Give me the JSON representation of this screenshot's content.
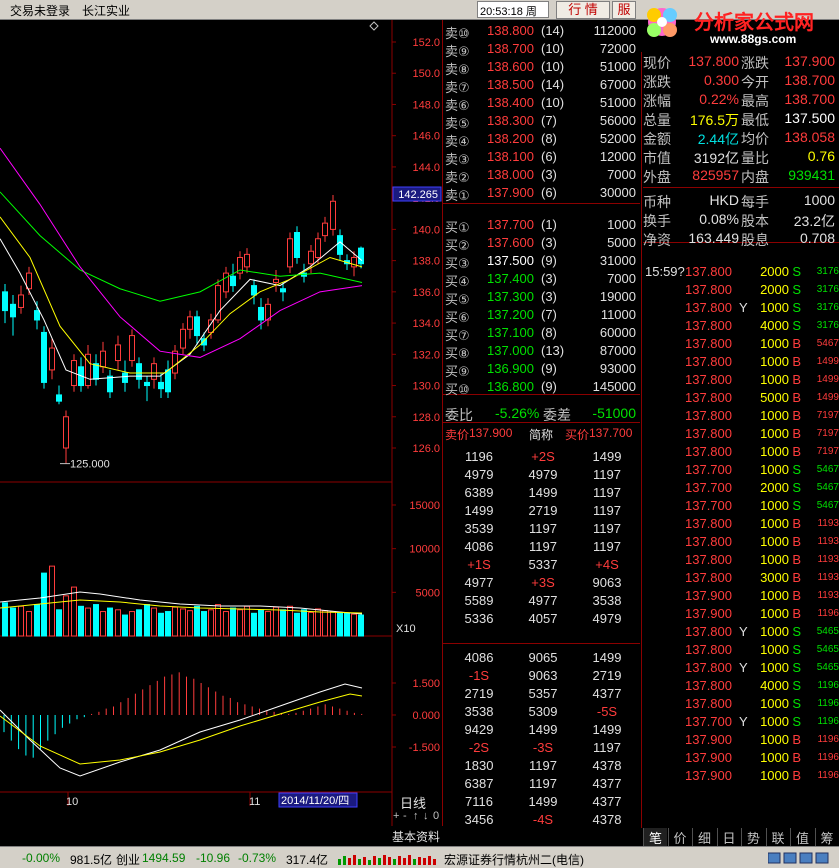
{
  "topbar": {
    "login_status": "交易未登录",
    "stock_name": "长江实业",
    "time": "20:53:18 周四",
    "btn_quote": "行 情",
    "btn_info": "服"
  },
  "watermark": {
    "brand": "分析家公式网",
    "url": "www.88gs.com"
  },
  "chart": {
    "price_ticks": [
      "152.0",
      "150.0",
      "148.0",
      "146.0",
      "144.0",
      "142.0",
      "140.0",
      "138.0",
      "136.0",
      "134.0",
      "132.0",
      "130.0",
      "128.0",
      "126.0"
    ],
    "current_price_marker": "142.265",
    "low_marker": "125.000",
    "vol_ticks": [
      "15000",
      "10000",
      "5000"
    ],
    "vol_unit": "X10",
    "macd_ticks": [
      "1.500",
      "0.000",
      "-1.500"
    ],
    "date_labels": [
      "10",
      "11"
    ],
    "date_cursor": "2014/11/20/四",
    "period_label": "日线",
    "fundamentals_label": "基本资料",
    "nav_buttons": [
      "+",
      "-",
      "↑",
      "↓",
      "0"
    ],
    "colors": {
      "up": "#ff3c3c",
      "down": "#00ffff",
      "ma5": "#ffffff",
      "ma10": "#ffff00",
      "ma20": "#00ff00",
      "ma60": "#ff00ff",
      "grid": "#8b0000"
    }
  },
  "orderbook": {
    "asks": [
      {
        "label": "卖⑩",
        "price": "138.800",
        "count": "(14)",
        "volume": "112000"
      },
      {
        "label": "卖⑨",
        "price": "138.700",
        "count": "(10)",
        "volume": "72000"
      },
      {
        "label": "卖⑧",
        "price": "138.600",
        "count": "(10)",
        "volume": "51000"
      },
      {
        "label": "卖⑦",
        "price": "138.500",
        "count": "(14)",
        "volume": "67000"
      },
      {
        "label": "卖⑥",
        "price": "138.400",
        "count": "(10)",
        "volume": "51000"
      },
      {
        "label": "卖⑤",
        "price": "138.300",
        "count": "(7)",
        "volume": "56000"
      },
      {
        "label": "卖④",
        "price": "138.200",
        "count": "(8)",
        "volume": "52000"
      },
      {
        "label": "卖③",
        "price": "138.100",
        "count": "(6)",
        "volume": "12000"
      },
      {
        "label": "卖②",
        "price": "138.000",
        "count": "(3)",
        "volume": "7000"
      },
      {
        "label": "卖①",
        "price": "137.900",
        "count": "(6)",
        "volume": "30000"
      }
    ],
    "bids": [
      {
        "label": "买①",
        "price": "137.700",
        "count": "(1)",
        "volume": "1000",
        "color": "red"
      },
      {
        "label": "买②",
        "price": "137.600",
        "count": "(3)",
        "volume": "5000",
        "color": "red"
      },
      {
        "label": "买③",
        "price": "137.500",
        "count": "(9)",
        "volume": "31000",
        "color": "white"
      },
      {
        "label": "买④",
        "price": "137.400",
        "count": "(3)",
        "volume": "7000",
        "color": "green"
      },
      {
        "label": "买⑤",
        "price": "137.300",
        "count": "(3)",
        "volume": "19000",
        "color": "green"
      },
      {
        "label": "买⑥",
        "price": "137.200",
        "count": "(7)",
        "volume": "11000",
        "color": "green"
      },
      {
        "label": "买⑦",
        "price": "137.100",
        "count": "(8)",
        "volume": "60000",
        "color": "green"
      },
      {
        "label": "买⑧",
        "price": "137.000",
        "count": "(13)",
        "volume": "87000",
        "color": "green"
      },
      {
        "label": "买⑨",
        "price": "136.900",
        "count": "(9)",
        "volume": "93000",
        "color": "green"
      },
      {
        "label": "买⑩",
        "price": "136.800",
        "count": "(9)",
        "volume": "145000",
        "color": "green"
      }
    ],
    "ratio_label": "委比",
    "ratio": "-5.26%",
    "diff_label": "委差",
    "diff": "-51000"
  },
  "stats": [
    [
      {
        "t": "现价",
        "c": "#c0c0c0"
      },
      {
        "t": "137.800",
        "c": "#ff3c3c"
      },
      {
        "t": "涨跌",
        "c": "#c0c0c0"
      },
      {
        "t": "137.900",
        "c": "#ff3c3c"
      }
    ],
    [
      {
        "t": "涨跌",
        "c": "#c0c0c0"
      },
      {
        "t": "0.300",
        "c": "#ff3c3c"
      },
      {
        "t": "今开",
        "c": "#c0c0c0"
      },
      {
        "t": "138.700",
        "c": "#ff3c3c"
      }
    ],
    [
      {
        "t": "涨幅",
        "c": "#c0c0c0"
      },
      {
        "t": "0.22%",
        "c": "#ff3c3c"
      },
      {
        "t": "最高",
        "c": "#c0c0c0"
      },
      {
        "t": "138.700",
        "c": "#ff3c3c"
      }
    ],
    [
      {
        "t": "总量",
        "c": "#c0c0c0"
      },
      {
        "t": "176.5万",
        "c": "#ffff00"
      },
      {
        "t": "最低",
        "c": "#c0c0c0"
      },
      {
        "t": "137.500",
        "c": "#ffffff"
      }
    ],
    [
      {
        "t": "金额",
        "c": "#c0c0c0"
      },
      {
        "t": "2.44亿",
        "c": "#00e0e0"
      },
      {
        "t": "均价",
        "c": "#c0c0c0"
      },
      {
        "t": "138.058",
        "c": "#ff3c3c"
      }
    ],
    [
      {
        "t": "市值",
        "c": "#c0c0c0"
      },
      {
        "t": "3192亿",
        "c": "#e0e0e0"
      },
      {
        "t": "量比",
        "c": "#c0c0c0"
      },
      {
        "t": "0.76",
        "c": "#ffff00"
      }
    ],
    [
      {
        "t": "外盘",
        "c": "#c0c0c0"
      },
      {
        "t": "825957",
        "c": "#ff3c3c"
      },
      {
        "t": "内盘",
        "c": "#c0c0c0"
      },
      {
        "t": "939431",
        "c": "#00e000"
      }
    ],
    [
      {
        "t": "币种",
        "c": "#c0c0c0"
      },
      {
        "t": "HKD",
        "c": "#e0e0e0"
      },
      {
        "t": "每手",
        "c": "#c0c0c0"
      },
      {
        "t": "1000",
        "c": "#e0e0e0"
      }
    ],
    [
      {
        "t": "换手",
        "c": "#c0c0c0"
      },
      {
        "t": "0.08%",
        "c": "#e0e0e0"
      },
      {
        "t": "股本",
        "c": "#c0c0c0"
      },
      {
        "t": "23.2亿",
        "c": "#e0e0e0"
      }
    ],
    [
      {
        "t": "净资",
        "c": "#c0c0c0"
      },
      {
        "t": "163.449",
        "c": "#e0e0e0"
      },
      {
        "t": "股息",
        "c": "#c0c0c0"
      },
      {
        "t": "0.708",
        "c": "#e0e0e0"
      }
    ]
  ],
  "ticks": [
    {
      "time": "15:59?",
      "price": "137.800",
      "flag": "",
      "vol": "2000",
      "side": "S",
      "code": "3176"
    },
    {
      "time": "",
      "price": "137.800",
      "flag": "",
      "vol": "2000",
      "side": "S",
      "code": "3176"
    },
    {
      "time": "",
      "price": "137.800",
      "flag": "Y",
      "vol": "1000",
      "side": "S",
      "code": "3176"
    },
    {
      "time": "",
      "price": "137.800",
      "flag": "",
      "vol": "4000",
      "side": "S",
      "code": "3176"
    },
    {
      "time": "",
      "price": "137.800",
      "flag": "",
      "vol": "1000",
      "side": "B",
      "code": "5467"
    },
    {
      "time": "",
      "price": "137.800",
      "flag": "",
      "vol": "1000",
      "side": "B",
      "code": "1499"
    },
    {
      "time": "",
      "price": "137.800",
      "flag": "",
      "vol": "1000",
      "side": "B",
      "code": "1499"
    },
    {
      "time": "",
      "price": "137.800",
      "flag": "",
      "vol": "5000",
      "side": "B",
      "code": "1499"
    },
    {
      "time": "",
      "price": "137.800",
      "flag": "",
      "vol": "1000",
      "side": "B",
      "code": "7197"
    },
    {
      "time": "",
      "price": "137.800",
      "flag": "",
      "vol": "1000",
      "side": "B",
      "code": "7197"
    },
    {
      "time": "",
      "price": "137.800",
      "flag": "",
      "vol": "1000",
      "side": "B",
      "code": "7197"
    },
    {
      "time": "",
      "price": "137.700",
      "flag": "",
      "vol": "1000",
      "side": "S",
      "code": "5467"
    },
    {
      "time": "",
      "price": "137.700",
      "flag": "",
      "vol": "2000",
      "side": "S",
      "code": "5467"
    },
    {
      "time": "",
      "price": "137.700",
      "flag": "",
      "vol": "1000",
      "side": "S",
      "code": "5467"
    },
    {
      "time": "",
      "price": "137.800",
      "flag": "",
      "vol": "1000",
      "side": "B",
      "code": "1193"
    },
    {
      "time": "",
      "price": "137.800",
      "flag": "",
      "vol": "1000",
      "side": "B",
      "code": "1193"
    },
    {
      "time": "",
      "price": "137.800",
      "flag": "",
      "vol": "1000",
      "side": "B",
      "code": "1193"
    },
    {
      "time": "",
      "price": "137.800",
      "flag": "",
      "vol": "3000",
      "side": "B",
      "code": "1193"
    },
    {
      "time": "",
      "price": "137.900",
      "flag": "",
      "vol": "1000",
      "side": "B",
      "code": "1193"
    },
    {
      "time": "",
      "price": "137.900",
      "flag": "",
      "vol": "1000",
      "side": "B",
      "code": "1196"
    },
    {
      "time": "",
      "price": "137.800",
      "flag": "Y",
      "vol": "1000",
      "side": "S",
      "code": "5465"
    },
    {
      "time": "",
      "price": "137.800",
      "flag": "",
      "vol": "1000",
      "side": "S",
      "code": "5465"
    },
    {
      "time": "",
      "price": "137.800",
      "flag": "Y",
      "vol": "1000",
      "side": "S",
      "code": "5465"
    },
    {
      "time": "",
      "price": "137.800",
      "flag": "",
      "vol": "4000",
      "side": "S",
      "code": "1196"
    },
    {
      "time": "",
      "price": "137.800",
      "flag": "",
      "vol": "1000",
      "side": "S",
      "code": "1196"
    },
    {
      "time": "",
      "price": "137.700",
      "flag": "Y",
      "vol": "1000",
      "side": "S",
      "code": "1196"
    },
    {
      "time": "",
      "price": "137.900",
      "flag": "",
      "vol": "1000",
      "side": "B",
      "code": "1196"
    },
    {
      "time": "",
      "price": "137.900",
      "flag": "",
      "vol": "1000",
      "side": "B",
      "code": "1196"
    },
    {
      "time": "",
      "price": "137.900",
      "flag": "",
      "vol": "1000",
      "side": "B",
      "code": "1196"
    }
  ],
  "queue": {
    "sell_label": "卖价",
    "sell_price": "137.900",
    "mid_label": "简称",
    "buy_label": "买价",
    "buy_price": "137.700",
    "upper": [
      [
        "1196",
        "+2S",
        "1499"
      ],
      [
        "4979",
        "4979",
        "1197"
      ],
      [
        "6389",
        "1499",
        "1197"
      ],
      [
        "1499",
        "2719",
        "1197"
      ],
      [
        "3539",
        "1197",
        "1197"
      ],
      [
        "4086",
        "1197",
        "1197"
      ],
      [
        "+1S",
        "5337",
        "+4S"
      ],
      [
        "4977",
        "+3S",
        "9063"
      ],
      [
        "5589",
        "4977",
        "3538"
      ],
      [
        "5336",
        "4057",
        "4979"
      ]
    ],
    "lower": [
      [
        "4086",
        "9065",
        "1499"
      ],
      [
        "-1S",
        "9063",
        "2719"
      ],
      [
        "2719",
        "5357",
        "4377"
      ],
      [
        "3538",
        "5309",
        "-5S"
      ],
      [
        "9429",
        "1499",
        "1499"
      ],
      [
        "-2S",
        "-3S",
        "1197"
      ],
      [
        "1830",
        "1197",
        "4378"
      ],
      [
        "6387",
        "1197",
        "4377"
      ],
      [
        "7116",
        "1499",
        "4377"
      ],
      [
        "3456",
        "-4S",
        "4378"
      ]
    ]
  },
  "right_tabs": [
    "笔",
    "价",
    "细",
    "日",
    "势",
    "联",
    "值",
    "筹"
  ],
  "statusbar": {
    "idx1_chg": "-0.00%",
    "idx1_amt": "981.5亿",
    "idx2_name": "创业",
    "idx2_val": "1494.59",
    "idx2_chg": "-10.96",
    "idx2_pct": "-0.73%",
    "idx2_amt": "317.4亿",
    "server": "宏源证券行情杭州二(电信)"
  }
}
